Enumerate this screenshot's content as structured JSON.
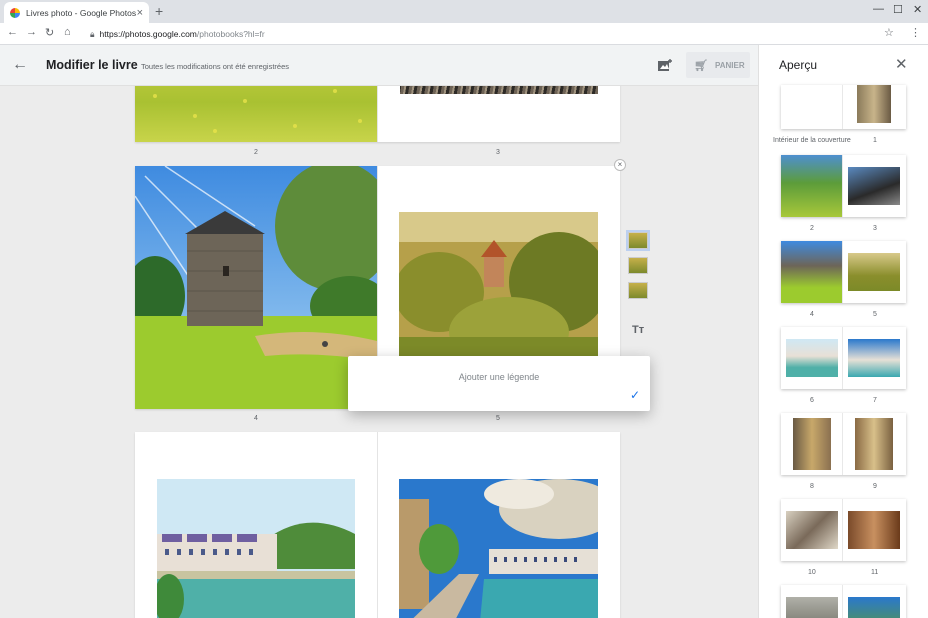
{
  "browser": {
    "tab_title": "Livres photo - Google Photos",
    "tab_close": "×",
    "new_tab": "+",
    "url_host": "https://photos.google.com",
    "url_path": "/photobooks?hl=fr",
    "icons": [
      "back-icon",
      "forward-icon",
      "reload-icon",
      "home-icon",
      "lock-icon",
      "star-icon",
      "menu-icon"
    ]
  },
  "header": {
    "title": "Modifier le livre",
    "status": "Toutes les modifications ont été enregistrées",
    "cart_label": "PANIER"
  },
  "preview": {
    "title": "Aperçu",
    "cover_label": "Intérieur de la couverture",
    "pages": [
      "1",
      "2",
      "3",
      "4",
      "5",
      "6",
      "7",
      "8",
      "9",
      "10",
      "11"
    ]
  },
  "editor": {
    "page_numbers": [
      "2",
      "3",
      "4",
      "5"
    ],
    "caption_placeholder": "Ajouter une légende",
    "text_tool_label": "Tт"
  },
  "colors": {
    "accent": "#1a73e8",
    "header_bg": "#f1f3f4",
    "canvas_bg": "#ececec"
  }
}
